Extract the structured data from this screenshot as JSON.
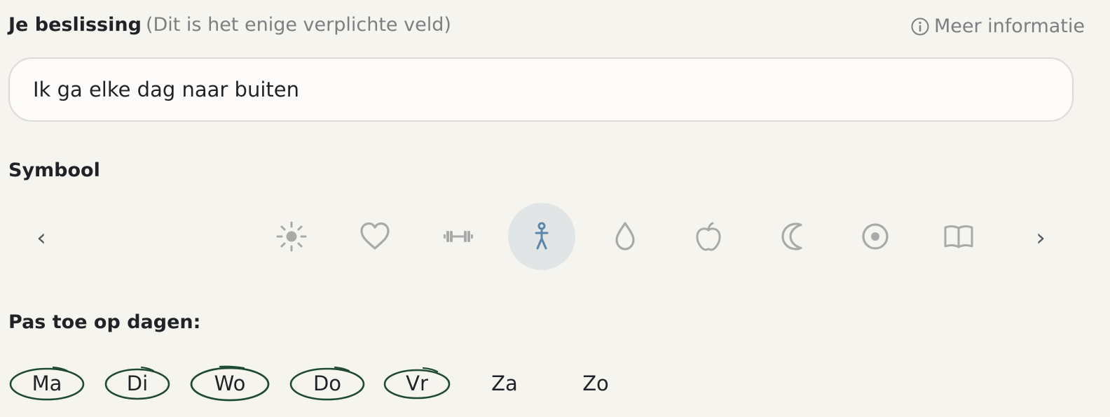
{
  "decision": {
    "label": "Je beslissing",
    "hint": "(Dit is het enige verplichte veld)",
    "info_link": "Meer informatie",
    "value": "Ik ga elke dag naar buiten"
  },
  "symbols": {
    "title": "Symbool",
    "prev": "‹",
    "next": "›",
    "items": [
      "sun-icon",
      "heart-icon",
      "dumbbell-icon",
      "walking-person-icon",
      "water-drop-icon",
      "apple-icon",
      "moon-icon",
      "target-icon",
      "book-icon"
    ],
    "selected": "walking-person-icon"
  },
  "days": {
    "title": "Pas toe op dagen:",
    "items": [
      {
        "label": "Ma",
        "selected": true
      },
      {
        "label": "Di",
        "selected": true
      },
      {
        "label": "Wo",
        "selected": true
      },
      {
        "label": "Do",
        "selected": true
      },
      {
        "label": "Vr",
        "selected": true
      },
      {
        "label": "Za",
        "selected": false
      },
      {
        "label": "Zo",
        "selected": false
      }
    ]
  },
  "colors": {
    "background": "#f6f4ef",
    "icon_inactive": "#a9a9a9",
    "icon_active": "#5b86a8",
    "selected_circle": "#e1e5e6",
    "day_ring": "#1f4a32"
  }
}
